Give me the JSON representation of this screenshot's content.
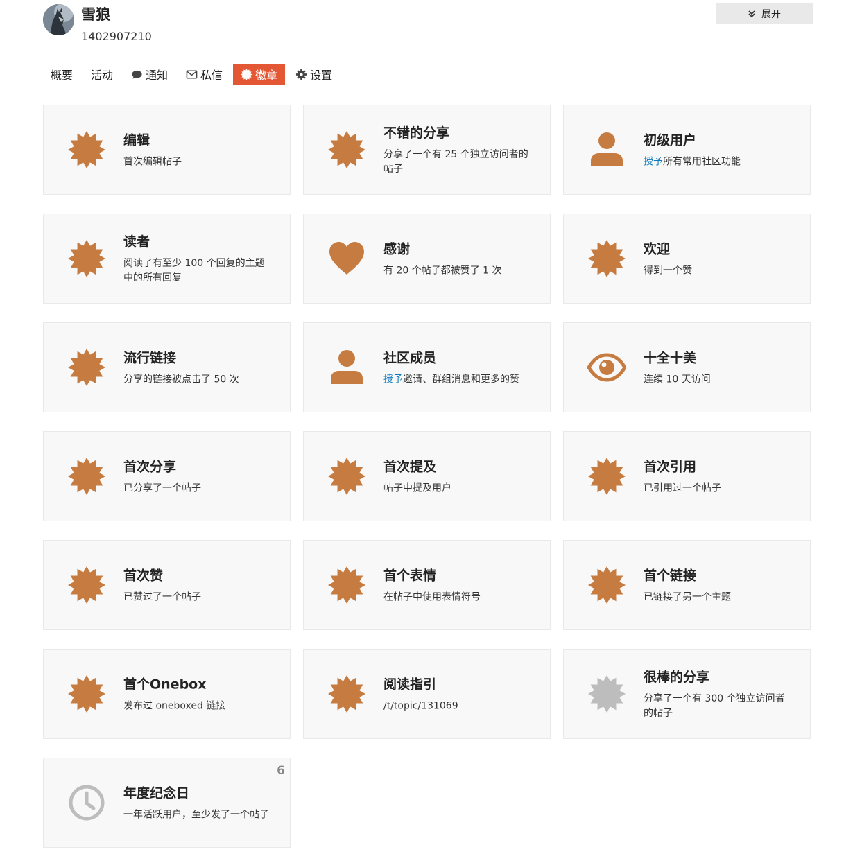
{
  "user": {
    "name": "雪狼",
    "id": "1402907210"
  },
  "header": {
    "expand_label": "展开"
  },
  "colors": {
    "accent": "#e45735",
    "badge_bronze": "#c67c41",
    "badge_gray": "#bdbdbd",
    "link": "#0a7bbf"
  },
  "nav": {
    "items": [
      {
        "label": "概要",
        "icon": "",
        "active": false
      },
      {
        "label": "活动",
        "icon": "",
        "active": false
      },
      {
        "label": "通知",
        "icon": "comment-icon",
        "active": false
      },
      {
        "label": "私信",
        "icon": "envelope-icon",
        "active": false
      },
      {
        "label": "徽章",
        "icon": "certificate-icon",
        "active": true
      },
      {
        "label": "设置",
        "icon": "gear-icon",
        "active": false
      }
    ]
  },
  "badges": [
    {
      "title": "编辑",
      "desc_link": "",
      "desc": "首次编辑帖子",
      "icon": "certificate-icon",
      "color": "bronze",
      "count": ""
    },
    {
      "title": "不错的分享",
      "desc_link": "",
      "desc": "分享了一个有 25 个独立访问者的帖子",
      "icon": "certificate-icon",
      "color": "bronze",
      "count": ""
    },
    {
      "title": "初级用户",
      "desc_link": "授予",
      "desc": "所有常用社区功能",
      "icon": "user-icon",
      "color": "bronze",
      "count": ""
    },
    {
      "title": "读者",
      "desc_link": "",
      "desc": "阅读了有至少 100 个回复的主题中的所有回复",
      "icon": "certificate-icon",
      "color": "bronze",
      "count": ""
    },
    {
      "title": "感谢",
      "desc_link": "",
      "desc": "有 20 个帖子都被赞了 1 次",
      "icon": "heart-icon",
      "color": "bronze",
      "count": ""
    },
    {
      "title": "欢迎",
      "desc_link": "",
      "desc": "得到一个赞",
      "icon": "certificate-icon",
      "color": "bronze",
      "count": ""
    },
    {
      "title": "流行链接",
      "desc_link": "",
      "desc": "分享的链接被点击了 50 次",
      "icon": "certificate-icon",
      "color": "bronze",
      "count": ""
    },
    {
      "title": "社区成员",
      "desc_link": "授予",
      "desc": "邀请、群组消息和更多的赞",
      "icon": "user-icon",
      "color": "bronze",
      "count": ""
    },
    {
      "title": "十全十美",
      "desc_link": "",
      "desc": "连续 10 天访问",
      "icon": "eye-icon",
      "color": "bronze",
      "count": ""
    },
    {
      "title": "首次分享",
      "desc_link": "",
      "desc": "已分享了一个帖子",
      "icon": "certificate-icon",
      "color": "bronze",
      "count": ""
    },
    {
      "title": "首次提及",
      "desc_link": "",
      "desc": "帖子中提及用户",
      "icon": "certificate-icon",
      "color": "bronze",
      "count": ""
    },
    {
      "title": "首次引用",
      "desc_link": "",
      "desc": "已引用过一个帖子",
      "icon": "certificate-icon",
      "color": "bronze",
      "count": ""
    },
    {
      "title": "首次赞",
      "desc_link": "",
      "desc": "已赞过了一个帖子",
      "icon": "certificate-icon",
      "color": "bronze",
      "count": ""
    },
    {
      "title": "首个表情",
      "desc_link": "",
      "desc": "在帖子中使用表情符号",
      "icon": "certificate-icon",
      "color": "bronze",
      "count": ""
    },
    {
      "title": "首个链接",
      "desc_link": "",
      "desc": "已链接了另一个主题",
      "icon": "certificate-icon",
      "color": "bronze",
      "count": ""
    },
    {
      "title": "首个Onebox",
      "desc_link": "",
      "desc": "发布过 oneboxed 链接",
      "icon": "certificate-icon",
      "color": "bronze",
      "count": ""
    },
    {
      "title": "阅读指引",
      "desc_link": "",
      "desc": "/t/topic/131069",
      "icon": "certificate-icon",
      "color": "bronze",
      "count": ""
    },
    {
      "title": "很棒的分享",
      "desc_link": "",
      "desc": "分享了一个有 300 个独立访问者的帖子",
      "icon": "certificate-icon",
      "color": "gray",
      "count": ""
    },
    {
      "title": "年度纪念日",
      "desc_link": "",
      "desc": "一年活跃用户，至少发了一个帖子",
      "icon": "clock-icon",
      "color": "gray",
      "count": "6"
    }
  ]
}
